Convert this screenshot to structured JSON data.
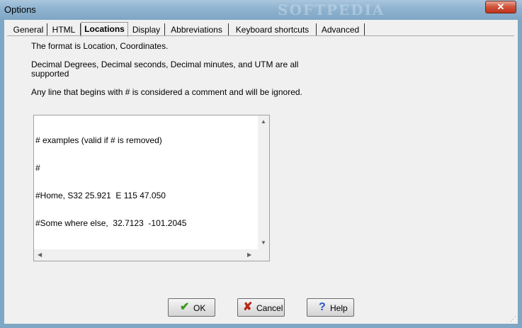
{
  "window": {
    "title": "Options",
    "watermark": "SOFTPEDIA",
    "close_label": "✕"
  },
  "tabs": [
    "General",
    "HTML",
    "Locations",
    "Display",
    "Abbreviations",
    "Keyboard shortcuts",
    "Advanced"
  ],
  "active_tab": "Locations",
  "locations": {
    "line1": "The format is Location, Coordinates.",
    "line2a": "Decimal Degrees, Decimal seconds, Decimal minutes, and UTM are all",
    "line2b": "supported",
    "line3": "Any line that begins with # is considered a comment and will be ignored.",
    "editor_lines": [
      "# examples (valid if # is removed)",
      "#",
      "#Home, S32 25.921  E 115 47.050",
      "#Some where else,  32.7123  -101.2045"
    ]
  },
  "buttons": {
    "ok_label": "OK",
    "cancel_label": "Cancel",
    "help_label": "Help"
  },
  "colors": {
    "ok_icon": "#3a9a1c",
    "cancel_icon": "#b8281a",
    "help_icon": "#2a55c8"
  },
  "icons": {
    "ok": "checkmark-icon",
    "cancel": "x-icon",
    "help": "question-icon"
  }
}
